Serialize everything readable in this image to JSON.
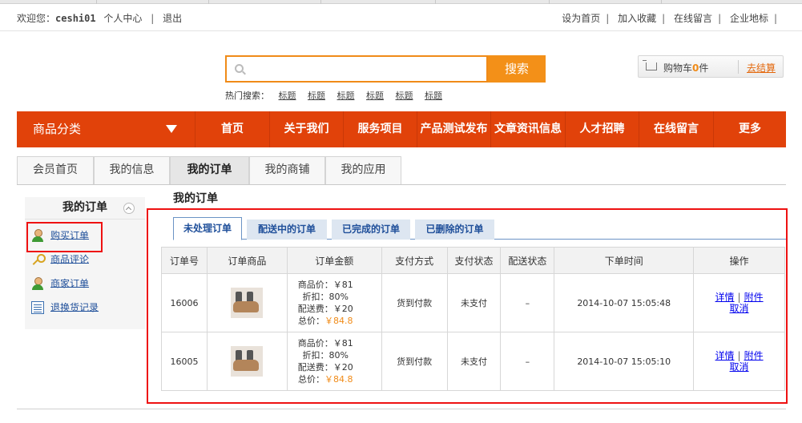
{
  "topbar": {
    "welcome": "欢迎您：",
    "username": "ceshi01",
    "user_center": "个人中心",
    "logout": "退出",
    "links": [
      "设为首页",
      "加入收藏",
      "在线留言",
      "企业地标"
    ]
  },
  "search": {
    "placeholder": "",
    "button": "搜索",
    "hot_label": "热门搜索：",
    "hot_keywords": [
      "标题",
      "标题",
      "标题",
      "标题",
      "标题",
      "标题"
    ]
  },
  "cart": {
    "label": "购物车",
    "count": "0",
    "unit": "件",
    "checkout": "去结算"
  },
  "nav": {
    "category": "商品分类",
    "items": [
      "首页",
      "关于我们",
      "服务项目",
      "产品测试发布",
      "文章资讯信息",
      "人才招聘",
      "在线留言",
      "更多"
    ]
  },
  "member_tabs": [
    "会员首页",
    "我的信息",
    "我的订单",
    "我的商铺",
    "我的应用"
  ],
  "member_tabs_active": "我的订单",
  "sidebar": {
    "title": "我的订单",
    "items": [
      {
        "label": "购买订单",
        "icon": "user-icon"
      },
      {
        "label": "商品评论",
        "icon": "key-icon"
      },
      {
        "label": "商家订单",
        "icon": "user-icon"
      },
      {
        "label": "退换货记录",
        "icon": "list-icon"
      }
    ]
  },
  "main": {
    "title": "我的订单",
    "order_tabs": [
      "未处理订单",
      "配送中的订单",
      "已完成的订单",
      "已删除的订单"
    ],
    "order_tabs_active": "未处理订单",
    "columns": [
      "订单号",
      "订单商品",
      "订单金额",
      "支付方式",
      "支付状态",
      "配送状态",
      "下单时间",
      "操作"
    ],
    "orders": [
      {
        "id": "16006",
        "price_line": "商品价：￥81",
        "discount_line": "折扣：80%",
        "shipping_line": "配送费：￥20",
        "total_label": "总价：",
        "total_value": "￥84.8",
        "payment_method": "货到付款",
        "payment_status": "未支付",
        "delivery_status": "–",
        "time": "2014-10-07 15:05:48",
        "op_detail": "详情",
        "op_attachment": "附件",
        "op_cancel": "取消"
      },
      {
        "id": "16005",
        "price_line": "商品价：￥81",
        "discount_line": "折扣：80%",
        "shipping_line": "配送费：￥20",
        "total_label": "总价：",
        "total_value": "￥84.8",
        "payment_method": "货到付款",
        "payment_status": "未支付",
        "delivery_status": "–",
        "time": "2014-10-07 15:05:10",
        "op_detail": "详情",
        "op_attachment": "附件",
        "op_cancel": "取消"
      }
    ]
  },
  "colors": {
    "nav_bg": "#e1420a",
    "accent_orange": "#f39018",
    "link_blue": "#1f4f9a",
    "highlight_red": "#ee1111"
  }
}
